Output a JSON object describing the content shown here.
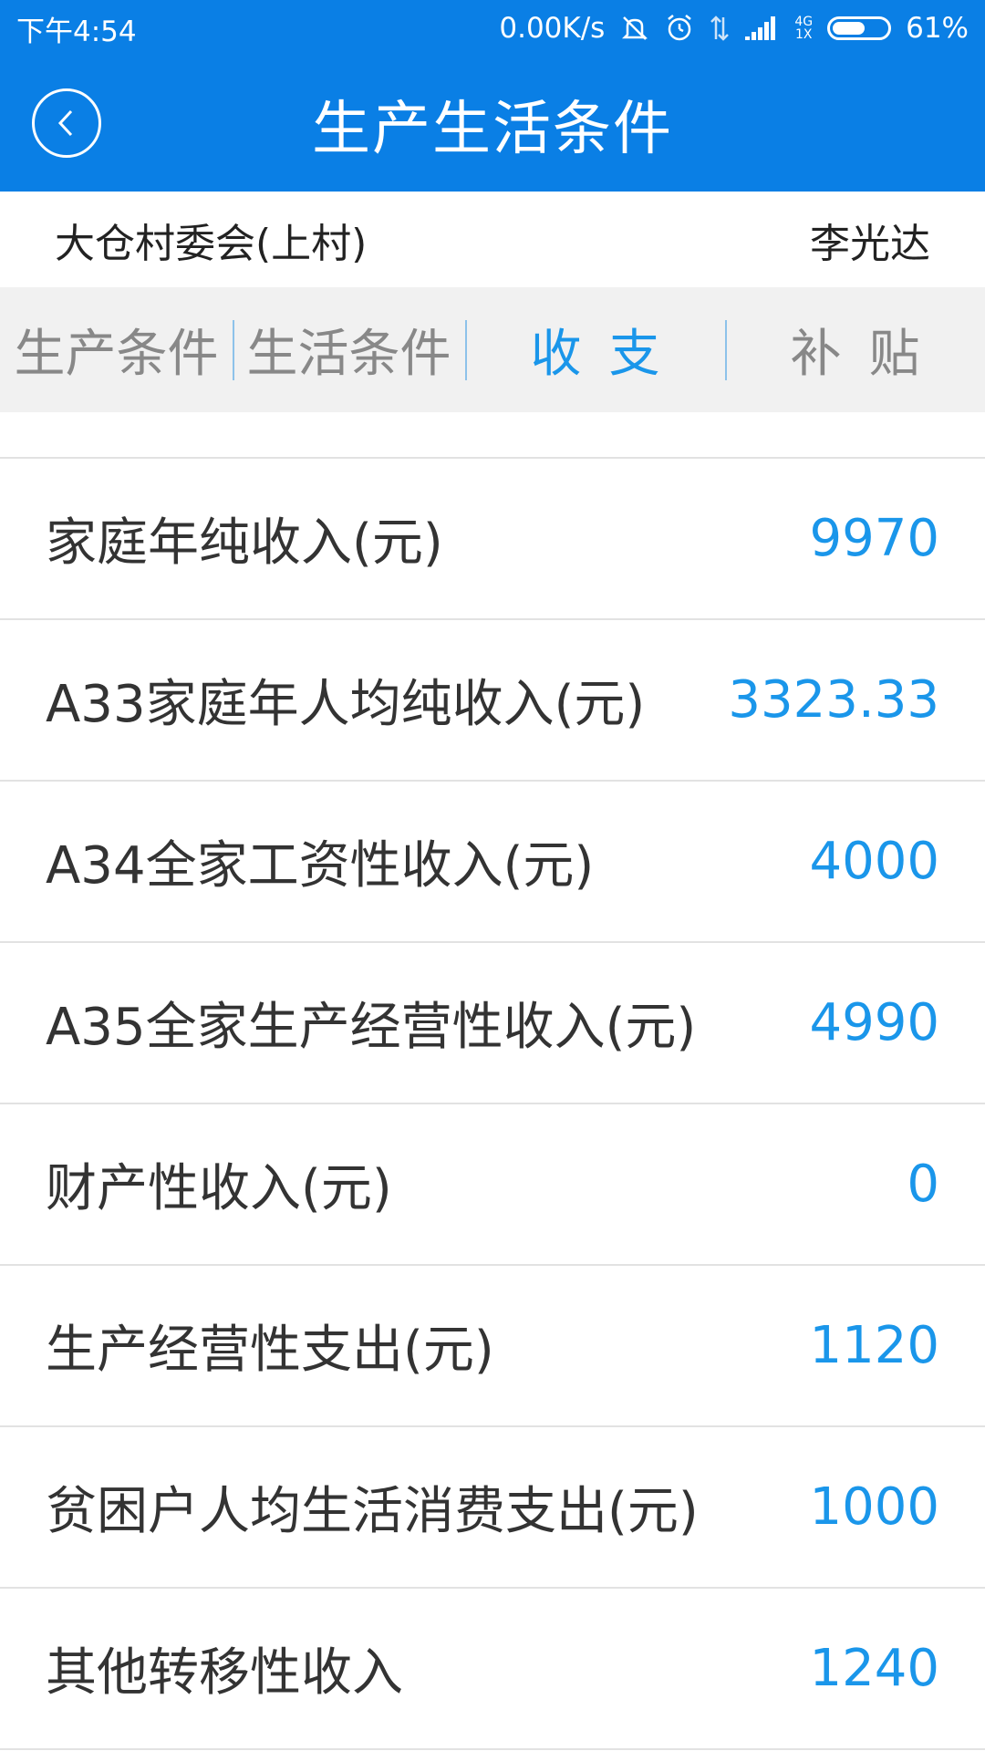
{
  "status_bar": {
    "time": "下午4:54",
    "net_speed": "0.00K/s",
    "network_top": "4G",
    "network_bottom": "1X",
    "battery_percent_text": "61%",
    "battery_level": 0.61,
    "icons": [
      "mute-icon",
      "alarm-icon",
      "data-arrows-icon",
      "signal-icon",
      "battery-icon"
    ]
  },
  "header": {
    "title": "生产生活条件",
    "back_icon": "chevron-left-icon",
    "color": "#0a7fe5"
  },
  "info": {
    "village": "大仓村委会(上村)",
    "person": "李光达"
  },
  "tabs": [
    {
      "label": "生产条件",
      "active": false
    },
    {
      "label": "生活条件",
      "active": false
    },
    {
      "label": "收支",
      "active": true
    },
    {
      "label": "补贴",
      "active": false
    }
  ],
  "rows": [
    {
      "label": "家庭年纯收入(元)",
      "value": "9970"
    },
    {
      "label": "A33家庭年人均纯收入(元)",
      "value": "3323.33"
    },
    {
      "label": "A34全家工资性收入(元)",
      "value": "4000"
    },
    {
      "label": "A35全家生产经营性收入(元)",
      "value": "4990"
    },
    {
      "label": "财产性收入(元)",
      "value": "0"
    },
    {
      "label": "生产经营性支出(元)",
      "value": "1120"
    },
    {
      "label": "贫困户人均生活消费支出(元)",
      "value": "1000"
    },
    {
      "label": "其他转移性收入",
      "value": "1240"
    }
  ],
  "colors": {
    "accent": "#1a96ea",
    "tab_background": "#f1f1f1"
  }
}
